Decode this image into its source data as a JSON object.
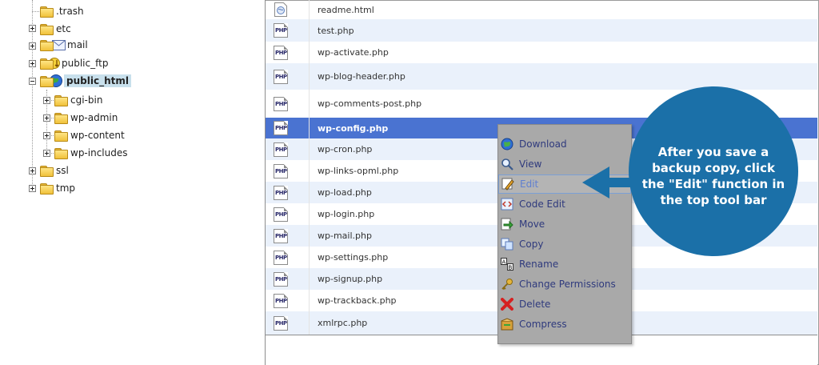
{
  "tree": {
    "items": [
      {
        "label": ".trash",
        "icon": "folder-icon"
      },
      {
        "label": "etc",
        "icon": "folder-icon"
      },
      {
        "label": "mail",
        "icon": "mail-folder-icon"
      },
      {
        "label": "public_ftp",
        "icon": "ftp-folder-icon"
      },
      {
        "label": "public_html",
        "icon": "web-folder-icon",
        "selected": true
      },
      {
        "label": "cgi-bin",
        "icon": "folder-icon"
      },
      {
        "label": "wp-admin",
        "icon": "folder-icon"
      },
      {
        "label": "wp-content",
        "icon": "folder-icon"
      },
      {
        "label": "wp-includes",
        "icon": "folder-icon"
      },
      {
        "label": "ssl",
        "icon": "folder-icon"
      },
      {
        "label": "tmp",
        "icon": "folder-icon"
      }
    ]
  },
  "files": {
    "rows": [
      {
        "name": "readme.html",
        "icon": "html-file-icon"
      },
      {
        "name": "test.php",
        "icon": "php-file-icon"
      },
      {
        "name": "wp-activate.php",
        "icon": "php-file-icon"
      },
      {
        "name": "wp-blog-header.php",
        "icon": "php-file-icon"
      },
      {
        "name": "wp-comments-post.php",
        "icon": "php-file-icon"
      },
      {
        "name": "wp-config.php",
        "icon": "php-file-icon",
        "selected": true
      },
      {
        "name": "wp-cron.php",
        "icon": "php-file-icon"
      },
      {
        "name": "wp-links-opml.php",
        "icon": "php-file-icon"
      },
      {
        "name": "wp-load.php",
        "icon": "php-file-icon"
      },
      {
        "name": "wp-login.php",
        "icon": "php-file-icon"
      },
      {
        "name": "wp-mail.php",
        "icon": "php-file-icon"
      },
      {
        "name": "wp-settings.php",
        "icon": "php-file-icon"
      },
      {
        "name": "wp-signup.php",
        "icon": "php-file-icon"
      },
      {
        "name": "wp-trackback.php",
        "icon": "php-file-icon"
      },
      {
        "name": "xmlrpc.php",
        "icon": "php-file-icon"
      }
    ],
    "php_badge": "PHP"
  },
  "context_menu": {
    "items": [
      {
        "label": "Download",
        "icon": "download-icon"
      },
      {
        "label": "View",
        "icon": "magnifier-icon"
      },
      {
        "label": "Edit",
        "icon": "edit-pencil-icon",
        "hover": true
      },
      {
        "label": "Code Edit",
        "icon": "code-edit-icon"
      },
      {
        "label": "Move",
        "icon": "move-arrow-icon"
      },
      {
        "label": "Copy",
        "icon": "copy-icon"
      },
      {
        "label": "Rename",
        "icon": "rename-icon"
      },
      {
        "label": "Change Permissions",
        "icon": "key-icon"
      },
      {
        "label": "Delete",
        "icon": "delete-x-icon"
      },
      {
        "label": "Compress",
        "icon": "compress-icon"
      }
    ]
  },
  "callout": {
    "text": "After you save a backup copy, click the \"Edit\" function in the top tool bar"
  },
  "colors": {
    "selected_row": "#4a73d1",
    "alt_row": "#eaf1fb",
    "menu_bg": "#a9a9a9",
    "menu_text": "#2f3a7d",
    "callout_bg": "#1b70a8"
  }
}
